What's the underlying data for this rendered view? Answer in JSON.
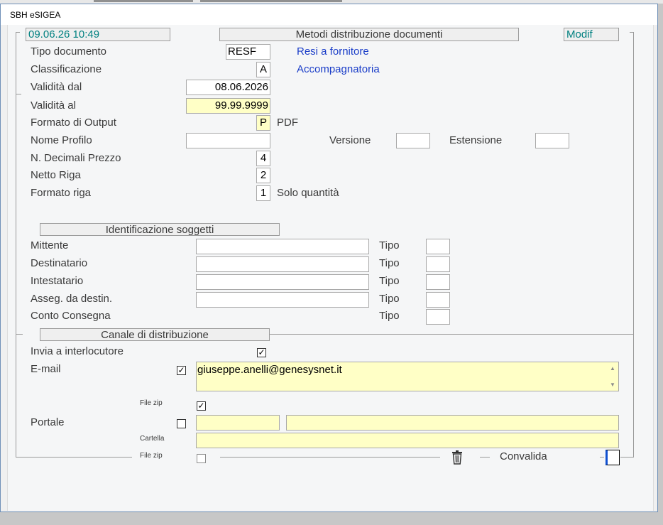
{
  "window": {
    "title": "SBH eSIGEA"
  },
  "header": {
    "datetime": "09.06.26 10:49",
    "section_title": "Metodi distribuzione documenti",
    "mode": "Modif"
  },
  "fields": {
    "tipo_documento": {
      "label": "Tipo documento",
      "value": "RESF",
      "description": "Resi a fornitore"
    },
    "classificazione": {
      "label": "Classificazione",
      "value": "A",
      "description": "Accompagnatoria"
    },
    "validita_dal": {
      "label": "Validità dal",
      "value": "08.06.2026"
    },
    "validita_al": {
      "label": "Validità  al",
      "value": "99.99.9999"
    },
    "formato_output": {
      "label": "Formato di Output",
      "value": "P",
      "description": "PDF"
    },
    "nome_profilo": {
      "label": "Nome Profilo",
      "value": ""
    },
    "versione": {
      "label": "Versione",
      "value": ""
    },
    "estensione": {
      "label": "Estensione",
      "value": ""
    },
    "decimali_prezzo": {
      "label": "N. Decimali  Prezzo",
      "value": "4"
    },
    "netto_riga": {
      "label": "Netto Riga",
      "value": "2"
    },
    "formato_riga": {
      "label": "Formato riga",
      "value": "1",
      "description": "Solo quantità"
    }
  },
  "soggetti": {
    "section_title": "Identificazione soggetti",
    "tipo_label": "Tipo",
    "rows": [
      {
        "label": "Mittente",
        "value": "",
        "tipo": ""
      },
      {
        "label": "Destinatario",
        "value": "",
        "tipo": ""
      },
      {
        "label": "Intestatario",
        "value": "",
        "tipo": ""
      },
      {
        "label": "Asseg. da destin.",
        "value": "",
        "tipo": ""
      },
      {
        "label": "Conto Consegna",
        "tipo": ""
      }
    ]
  },
  "canale": {
    "section_title": "Canale di distribuzione",
    "invia_interlocutore": {
      "label": "Invia a interlocutore",
      "checked": true
    },
    "email": {
      "label": "E-mail",
      "checked": true,
      "value": "giuseppe.anelli@genesysnet.it"
    },
    "email_zip": {
      "label": "File zip",
      "checked": true
    },
    "portale": {
      "label": "Portale",
      "checked": false,
      "value1": "",
      "value2": ""
    },
    "cartella": {
      "label": "Cartella",
      "value": ""
    },
    "portale_zip": {
      "label": "File zip",
      "checked": false
    }
  },
  "footer": {
    "delete_icon": "trash-icon",
    "convalida_label": "Convalida"
  },
  "icons": {
    "check": "✓",
    "scroll_up": "▲",
    "scroll_down": "▼",
    "trash": "🗑"
  },
  "colors": {
    "yellow_field": "#ffffc6",
    "link_blue": "#1a3dc8",
    "teal": "#008080",
    "window_border": "#6e8fb7"
  }
}
